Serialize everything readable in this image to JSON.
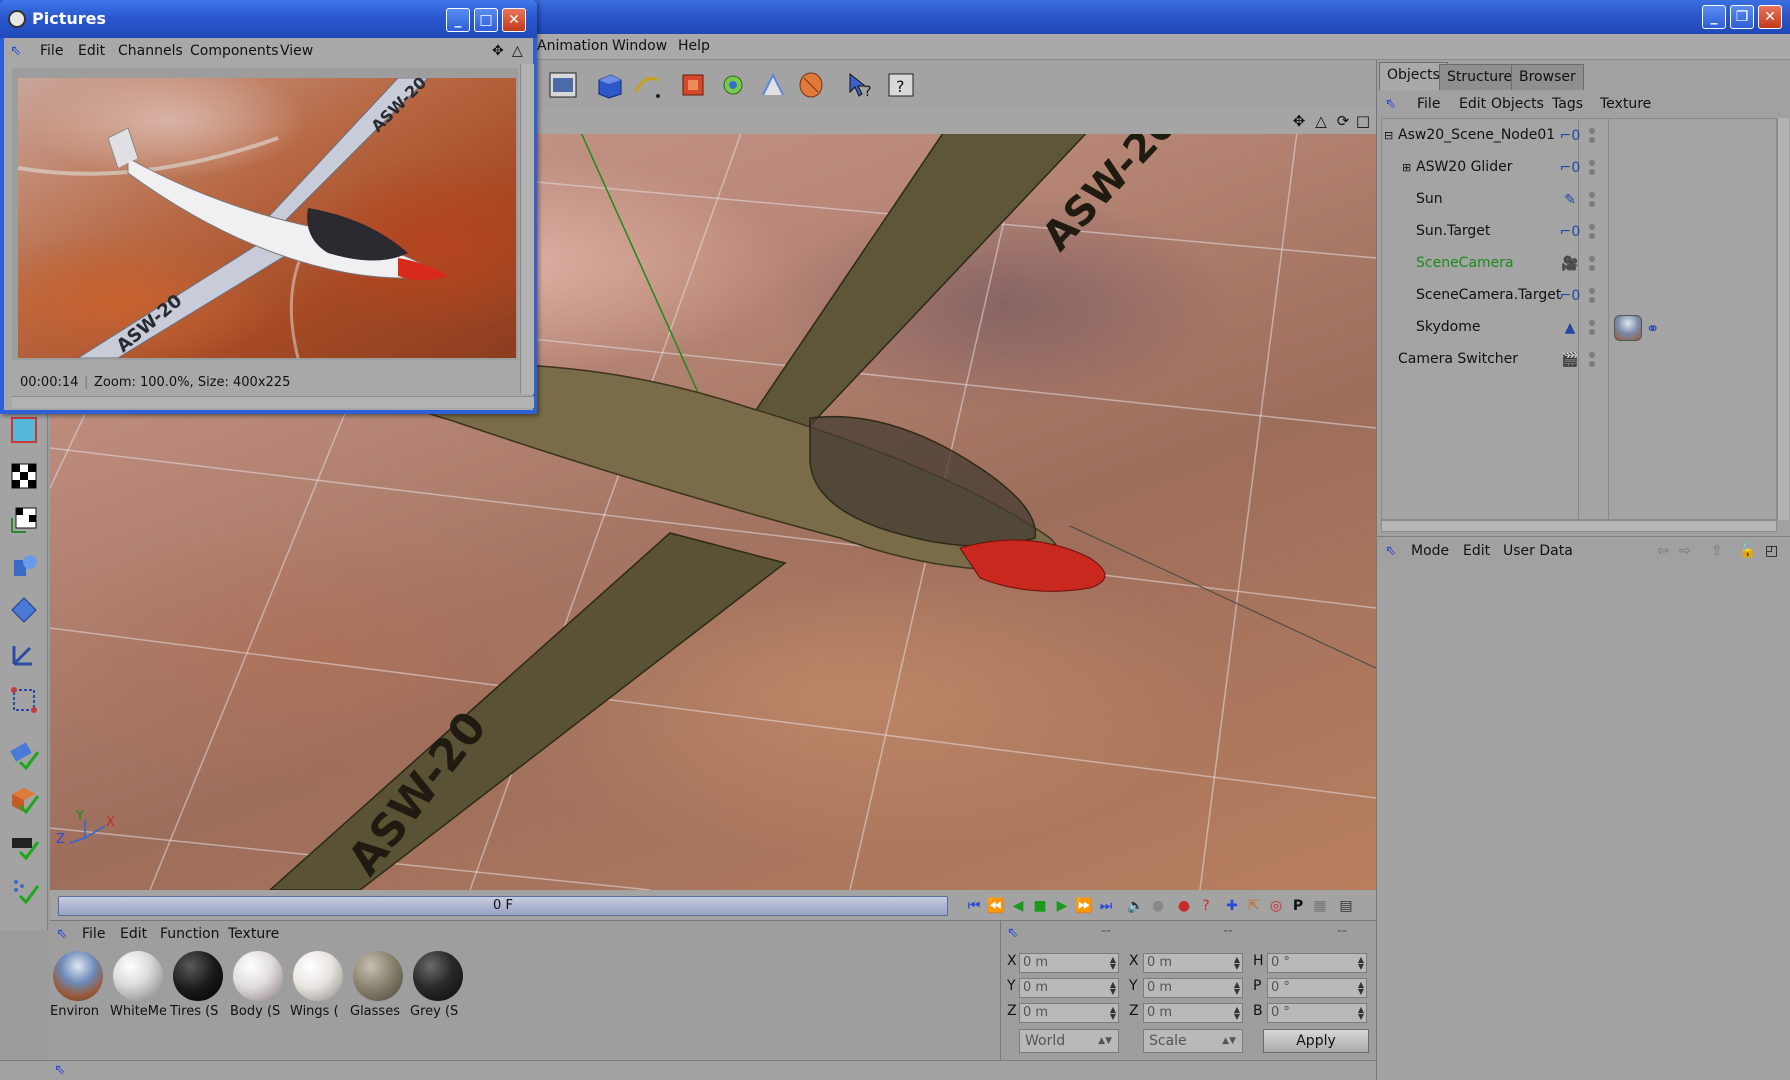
{
  "main_menu": [
    "Animation",
    "Window",
    "Help"
  ],
  "pictures_window": {
    "title": "Pictures",
    "menu": [
      "File",
      "Edit",
      "Channels",
      "Components",
      "View"
    ],
    "status_time": "00:00:14",
    "status_info": "Zoom: 100.0%, Size: 400x225",
    "image_text": "ASW-20"
  },
  "viewport": {
    "wing_text": "ASW-20",
    "axis_labels": {
      "z": "Z",
      "y": "Y",
      "x": "X"
    }
  },
  "timeline": {
    "frame": "0 F"
  },
  "material_manager": {
    "menu": [
      "File",
      "Edit",
      "Function",
      "Texture"
    ],
    "materials": [
      {
        "label": "Environ",
        "icon": "environment-material-icon"
      },
      {
        "label": "WhiteMe",
        "icon": "white-material-icon"
      },
      {
        "label": "Tires (S",
        "icon": "tires-material-icon"
      },
      {
        "label": "Body (S",
        "icon": "body-material-icon"
      },
      {
        "label": "Wings (",
        "icon": "wings-material-icon"
      },
      {
        "label": "Glasses",
        "icon": "glasses-material-icon"
      },
      {
        "label": "Grey (S",
        "icon": "grey-material-icon"
      }
    ]
  },
  "coordinates": {
    "header": [
      "--",
      "--",
      "--"
    ],
    "position": [
      {
        "axis": "X",
        "value": "0 m"
      },
      {
        "axis": "Y",
        "value": "0 m"
      },
      {
        "axis": "Z",
        "value": "0 m"
      }
    ],
    "size": [
      {
        "axis": "X",
        "value": "0 m"
      },
      {
        "axis": "Y",
        "value": "0 m"
      },
      {
        "axis": "Z",
        "value": "0 m"
      }
    ],
    "rotation": [
      {
        "axis": "H",
        "value": "0 °"
      },
      {
        "axis": "P",
        "value": "0 °"
      },
      {
        "axis": "B",
        "value": "0 °"
      }
    ],
    "mode_select": "World",
    "scale_select": "Scale",
    "apply_label": "Apply"
  },
  "object_manager": {
    "tabs": [
      "Objects",
      "Structure",
      "Browser"
    ],
    "active_tab": "Objects",
    "menu": [
      "File",
      "Edit",
      "Objects",
      "Tags",
      "Texture"
    ],
    "objects": [
      {
        "name": "Asw20_Scene_Node01",
        "tag": "null-object-icon",
        "color": "#111111"
      },
      {
        "name": "ASW20 Glider",
        "tag": "null-object-icon",
        "color": "#111111"
      },
      {
        "name": "Sun",
        "tag": "light-icon",
        "color": "#111111"
      },
      {
        "name": "Sun.Target",
        "tag": "null-object-icon",
        "color": "#111111"
      },
      {
        "name": "SceneCamera",
        "tag": "camera-icon",
        "color": "#1a8a1a"
      },
      {
        "name": "SceneCamera.Target",
        "tag": "null-object-icon",
        "color": "#111111"
      },
      {
        "name": "Skydome",
        "tag": "sky-icon",
        "color": "#111111"
      },
      {
        "name": "Camera Switcher",
        "tag": "clapper-icon",
        "color": "#111111"
      }
    ]
  },
  "attribute_manager": {
    "menu": [
      "Mode",
      "Edit",
      "User Data"
    ]
  }
}
